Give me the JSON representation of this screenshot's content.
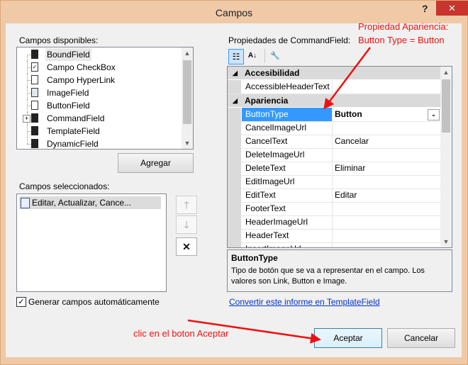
{
  "window": {
    "title": "Campos",
    "help_glyph": "?",
    "close_glyph": "✕"
  },
  "left": {
    "available_label": "Campos disponibles:",
    "available_fields": [
      {
        "label": "BoundField",
        "icon": "boundfield-icon",
        "highlighted": true
      },
      {
        "label": "Campo CheckBox",
        "icon": "checkbox-field-icon"
      },
      {
        "label": "Campo HyperLink",
        "icon": "hyperlink-field-icon"
      },
      {
        "label": "ImageField",
        "icon": "image-field-icon"
      },
      {
        "label": "ButtonField",
        "icon": "button-field-icon"
      },
      {
        "label": "CommandField",
        "icon": "command-field-icon",
        "expander": "+"
      },
      {
        "label": "TemplateField",
        "icon": "template-field-icon"
      },
      {
        "label": "DynamicField",
        "icon": "dynamic-field-icon"
      }
    ],
    "add_button": "Agregar",
    "selected_label": "Campos seleccionados:",
    "selected_fields": [
      {
        "label": "Editar, Actualizar, Cance...",
        "icon": "command-field-icon"
      }
    ],
    "move_up_glyph": "🡑",
    "move_down_glyph": "🡓",
    "delete_glyph": "✕",
    "auto_generate": {
      "label": "Generar campos automáticamente",
      "checked": true
    }
  },
  "right": {
    "properties_label": "Propiedades de CommandField:",
    "toolbar": [
      {
        "name": "categorized-view-icon",
        "glyph": "☷",
        "active": true
      },
      {
        "name": "alphabetical-sort-icon",
        "glyph": "A↓",
        "active": false
      },
      {
        "name": "property-pages-icon",
        "glyph": "🔧",
        "active": false
      }
    ],
    "categories": [
      {
        "name": "Accesibilidad",
        "rows": [
          {
            "name": "AccessibleHeaderText",
            "value": ""
          }
        ]
      },
      {
        "name": "Apariencia",
        "rows": [
          {
            "name": "ButtonType",
            "value": "Button",
            "selected": true
          },
          {
            "name": "CancelImageUrl",
            "value": ""
          },
          {
            "name": "CancelText",
            "value": "Cancelar"
          },
          {
            "name": "DeleteImageUrl",
            "value": ""
          },
          {
            "name": "DeleteText",
            "value": "Eliminar"
          },
          {
            "name": "EditImageUrl",
            "value": ""
          },
          {
            "name": "EditText",
            "value": "Editar"
          },
          {
            "name": "FooterText",
            "value": ""
          },
          {
            "name": "HeaderImageUrl",
            "value": ""
          },
          {
            "name": "HeaderText",
            "value": ""
          },
          {
            "name": "InsertImageUrl",
            "value": ""
          }
        ]
      }
    ],
    "category_expanded_glyph": "◢",
    "dropdown_glyph": "⌄",
    "description": {
      "title": "ButtonType",
      "text": "Tipo de botón que se va a representar en el campo. Los valores son Link, Button e Image."
    },
    "convert_link": "Convertir este informe en TemplateField"
  },
  "footer": {
    "ok_button": "Aceptar",
    "cancel_button": "Cancelar"
  },
  "annotations": {
    "top_right_line1": "Propiedad Apariencia:",
    "top_right_line2": "Button Type = Button",
    "bottom": "clic en el boton Aceptar",
    "color": "#ee1111"
  },
  "scroll_arrows": {
    "up": "▲",
    "down": "▼"
  }
}
